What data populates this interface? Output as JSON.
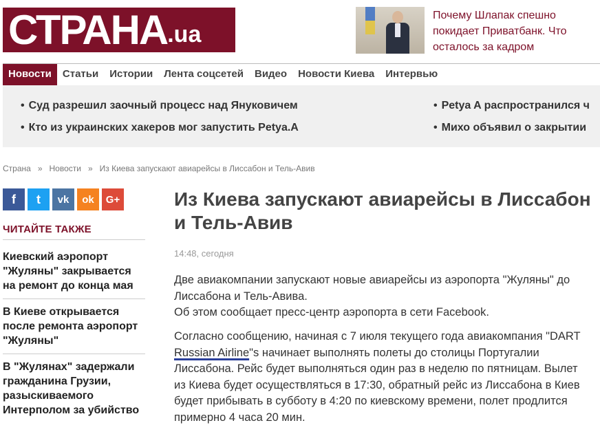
{
  "header": {
    "logo_main": "СТРАНА",
    "logo_suffix": ".ua",
    "promo_text": "Почему Шлапак спешно покидает Приватбанк. Что осталось за кадром"
  },
  "nav": [
    "Новости",
    "Статьи",
    "Истории",
    "Лента соцсетей",
    "Видео",
    "Новости Киева",
    "Интервью"
  ],
  "top_news": [
    "Суд разрешил заочный процесс над Януковичем",
    "Кто из украинских хакеров мог запустить Petya.A",
    "Petya A распространился ч",
    "Михо объявил о закрытии"
  ],
  "breadcrumb": [
    "Страна",
    "Новости",
    "Из Киева запускают авиарейсы в Лиссабон и Тель-Авив"
  ],
  "breadcrumb_sep": "»",
  "social": [
    {
      "icon": "facebook-icon",
      "glyph": "f",
      "color": "#3b5998"
    },
    {
      "icon": "twitter-icon",
      "glyph": "t",
      "color": "#1da1f2"
    },
    {
      "icon": "vk-icon",
      "glyph": "vk",
      "color": "#4c75a3"
    },
    {
      "icon": "odnoklassniki-icon",
      "glyph": "ok",
      "color": "#f58220"
    },
    {
      "icon": "google-plus-icon",
      "glyph": "G+",
      "color": "#dd4b39"
    }
  ],
  "read_also": {
    "heading": "ЧИТАЙТЕ ТАКЖЕ",
    "items": [
      "Киевский аэропорт \"Жуляны\" закрывается на ремонт до конца мая",
      "В Киеве открывается после ремонта аэропорт \"Жуляны\"",
      "В \"Жулянах\" задержали гражданина Грузии, разыскиваемого Интерполом за убийство"
    ]
  },
  "article": {
    "title": "Из Киева запускают авиарейсы в Лиссабон и Тель-Авив",
    "time": "14:48, сегодня",
    "p1_line1": "Две авиакомпании запускают новые авиарейсы из аэропорта \"Жуляны\" до Лиссабона и Тель-Авива.",
    "p1_line2": "Об этом сообщает пресс-центр аэропорта в сети Facebook.",
    "p2_before": "Согласно сообщению, начиная с 7 июля текущего года авиакомпания \"DART ",
    "p2_underlined": "Russian Airline",
    "p2_after": "\"s начинает выполнять полеты до столицы Португалии Лиссабона. Рейс будет выполняться один раз в неделю по пятницам. Вылет из Киева будет осуществляться в 17:30, обратный рейс из Лиссабона в Киев будет прибывать в субботу в 4:20 по киевскому времени, полет продлится примерно 4 часа 20 мин."
  },
  "colors": {
    "brand": "#7d1129",
    "underline": "#2a3f9a"
  }
}
